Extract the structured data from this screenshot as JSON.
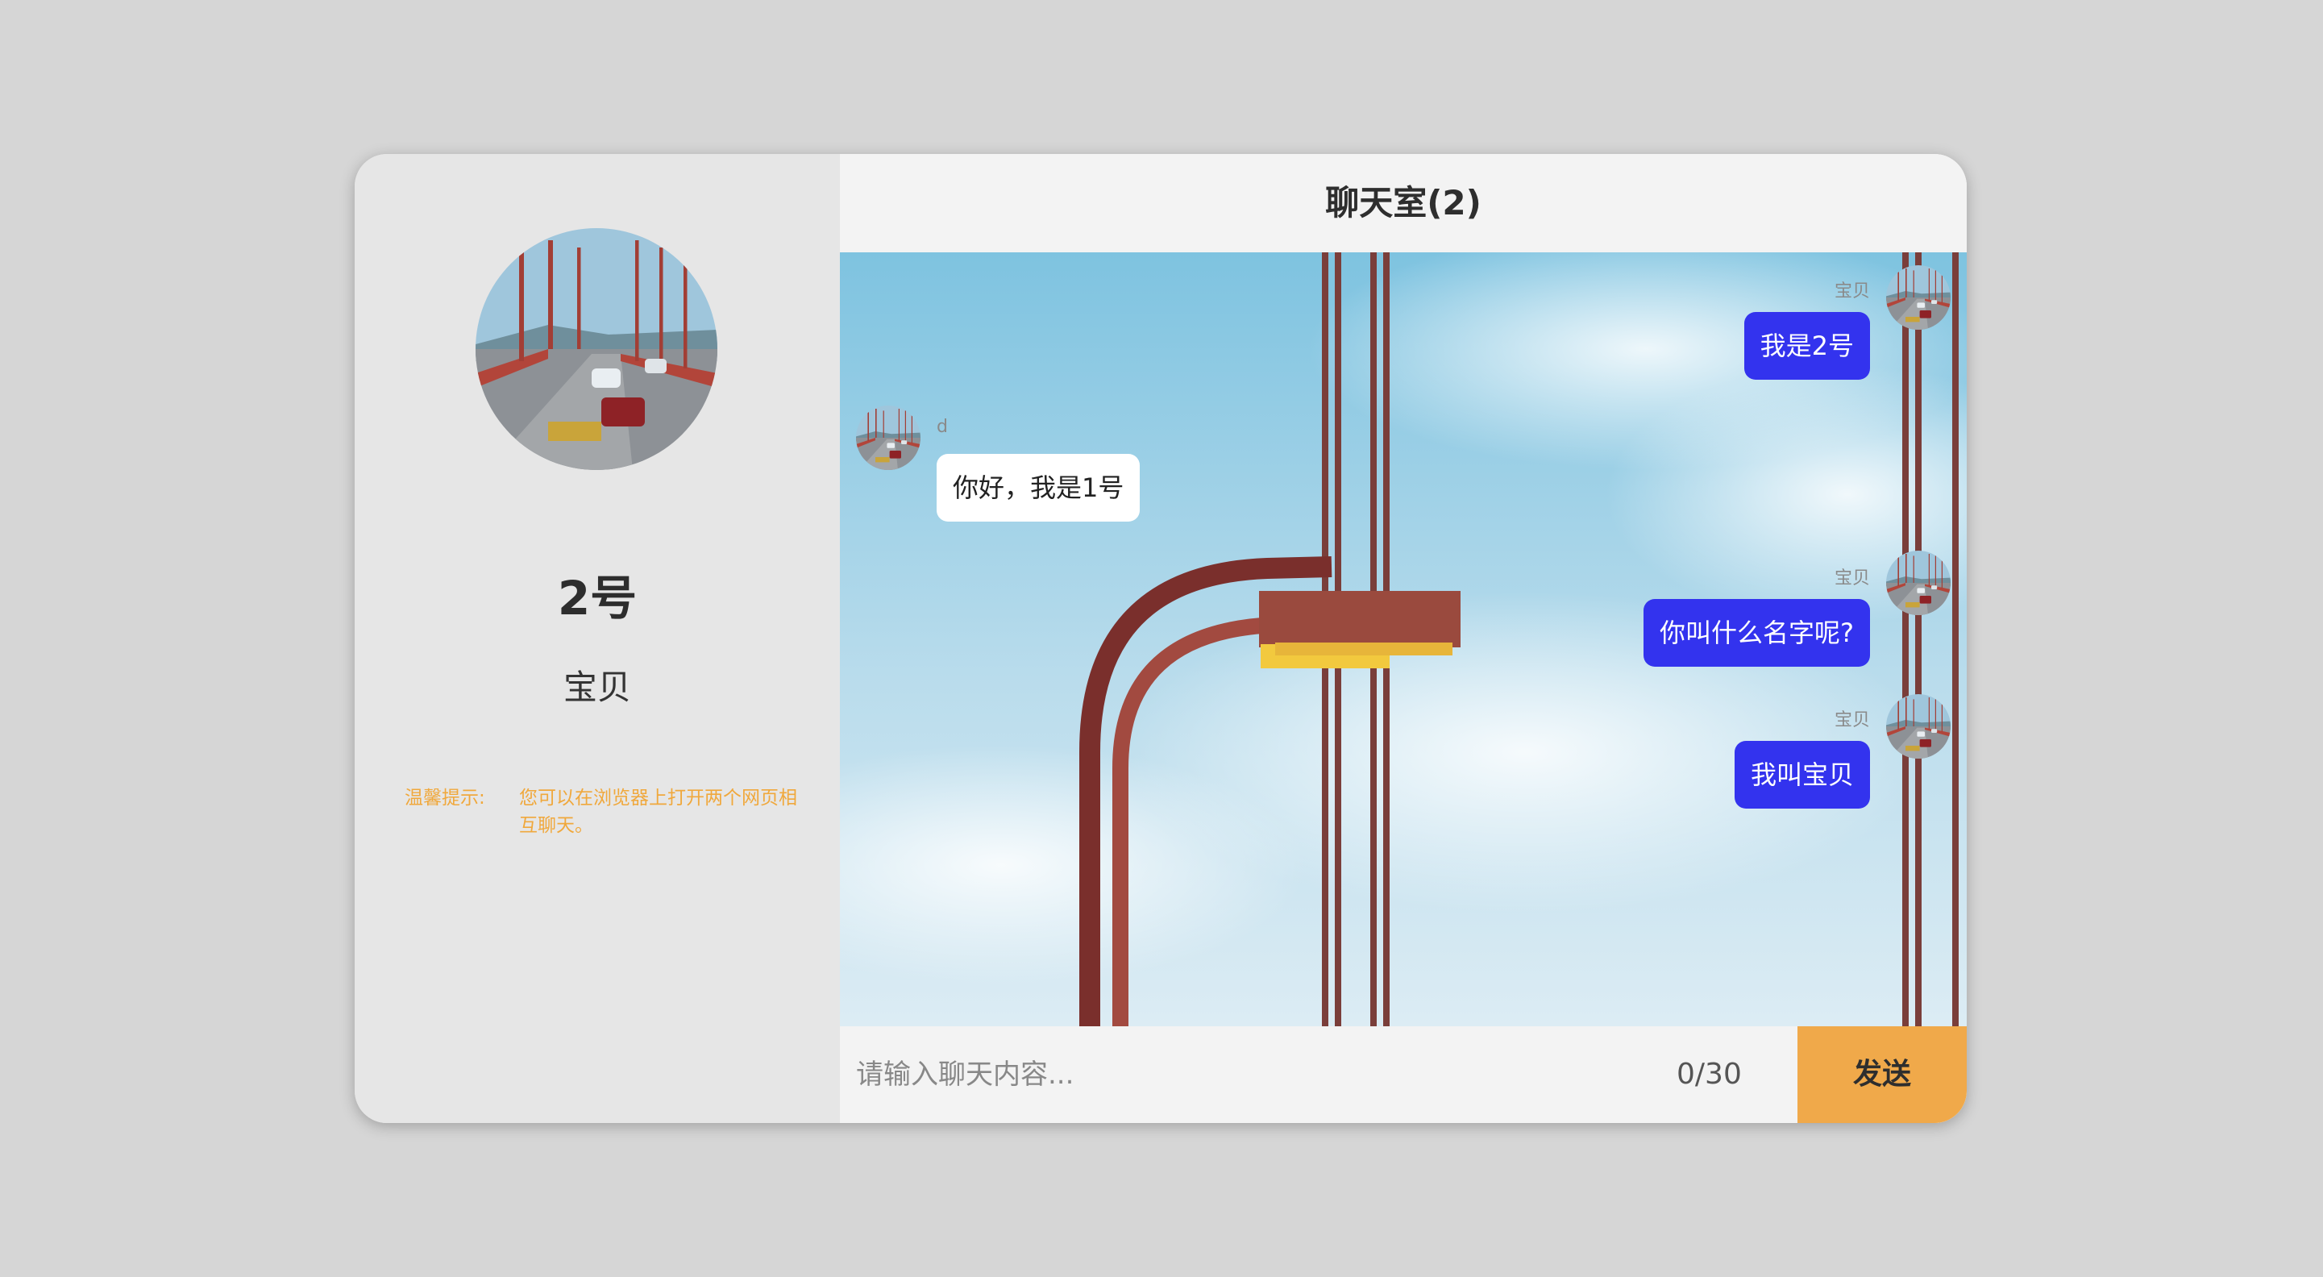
{
  "profile": {
    "name": "2号",
    "nickname": "宝贝",
    "tip_label": "温馨提示:",
    "tip_text": "您可以在浏览器上打开两个网页相互聊天。"
  },
  "chat": {
    "title": "聊天室(2)",
    "messages": [
      {
        "sender": "宝贝",
        "text": "我是2号",
        "side": "right"
      },
      {
        "sender": "d",
        "text": "你好，我是1号",
        "side": "left"
      },
      {
        "sender": "宝贝",
        "text": "你叫什么名字呢?",
        "side": "right"
      },
      {
        "sender": "宝贝",
        "text": "我叫宝贝",
        "side": "right"
      }
    ]
  },
  "input": {
    "placeholder": "请输入聊天内容...",
    "counter": "0/30",
    "send_label": "发送"
  },
  "colors": {
    "accent": "#f0a94a",
    "my_bubble": "#3333ee",
    "tip": "#f0a83c"
  }
}
